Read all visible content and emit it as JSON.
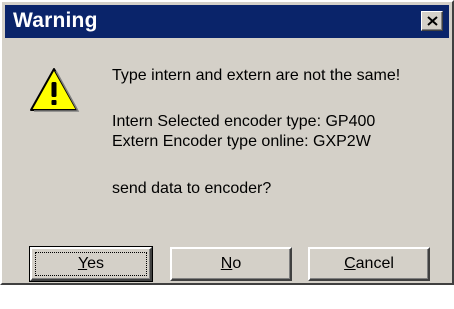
{
  "window": {
    "title": "Warning"
  },
  "icon": "warning-icon",
  "message": {
    "line1": "Type intern and extern are not the same!",
    "line2": "Intern Selected encoder type: GP400",
    "line3": "Extern Encoder type online: GXP2W",
    "line4": "send data to encoder?"
  },
  "buttons": {
    "yes": {
      "mnemonic": "Y",
      "rest": "es"
    },
    "no": {
      "mnemonic": "N",
      "rest": "o"
    },
    "cancel": {
      "mnemonic": "C",
      "rest": "ancel"
    }
  },
  "colors": {
    "titlebar": "#0a246a",
    "dialog_bg": "#d4d0c8",
    "warning_yellow": "#ffff00"
  }
}
